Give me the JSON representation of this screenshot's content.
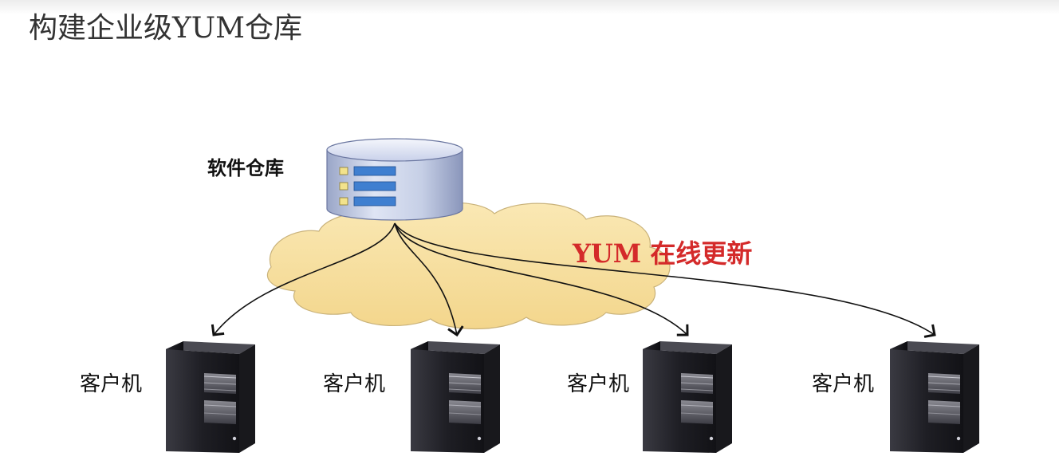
{
  "page": {
    "title": "构建企业级YUM仓库"
  },
  "diagram": {
    "repository": {
      "label": "软件仓库",
      "icon": "database-icon"
    },
    "network": {
      "label": "YUM 在线更新",
      "icon": "cloud-icon",
      "label_color": "#d42a2a",
      "fill_color": "#f7dea0"
    },
    "clients": [
      {
        "label": "客户机",
        "icon": "server-tower-icon"
      },
      {
        "label": "客户机",
        "icon": "server-tower-icon"
      },
      {
        "label": "客户机",
        "icon": "server-tower-icon"
      },
      {
        "label": "客户机",
        "icon": "server-tower-icon"
      }
    ]
  }
}
